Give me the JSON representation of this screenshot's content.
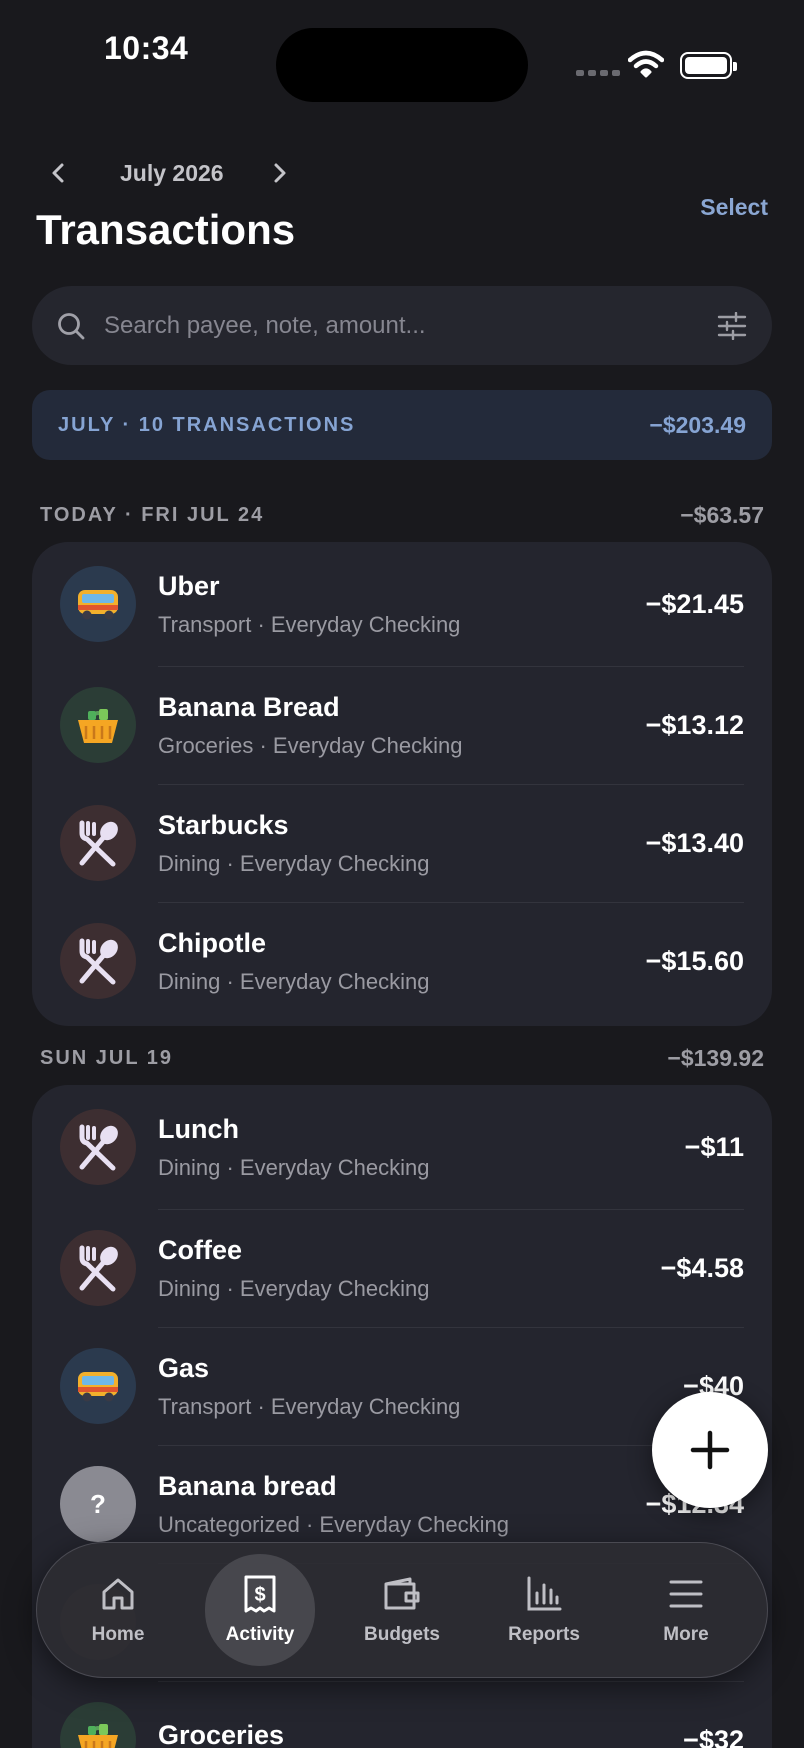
{
  "status_bar": {
    "time": "10:34"
  },
  "header": {
    "month": "July 2026",
    "title": "Transactions",
    "select_label": "Select"
  },
  "search": {
    "placeholder": "Search payee, note, amount..."
  },
  "summary": {
    "label": "JULY · 10 TRANSACTIONS",
    "total": "−$203.49"
  },
  "sections": [
    {
      "title": "TODAY · FRI JUL 24",
      "total": "−$63.57",
      "rows": [
        {
          "payee": "Uber",
          "meta": "Transport · Everyday Checking",
          "amount": "−$21.45",
          "icon": "bus-icon"
        },
        {
          "payee": "Banana Bread",
          "meta": "Groceries · Everyday Checking",
          "amount": "−$13.12",
          "icon": "basket-icon"
        },
        {
          "payee": "Starbucks",
          "meta": "Dining · Everyday Checking",
          "amount": "−$13.40",
          "icon": "fork-spoon-icon"
        },
        {
          "payee": "Chipotle",
          "meta": "Dining · Everyday Checking",
          "amount": "−$15.60",
          "icon": "fork-spoon-icon"
        }
      ]
    },
    {
      "title": "SUN JUL 19",
      "total": "−$139.92",
      "rows": [
        {
          "payee": "Lunch",
          "meta": "Dining · Everyday Checking",
          "amount": "−$11",
          "icon": "fork-spoon-icon"
        },
        {
          "payee": "Coffee",
          "meta": "Dining · Everyday Checking",
          "amount": "−$4.58",
          "icon": "fork-spoon-icon"
        },
        {
          "payee": "Gas",
          "meta": "Transport · Everyday Checking",
          "amount": "−$40",
          "icon": "bus-icon"
        },
        {
          "payee": "Banana bread",
          "meta": "Uncategorized · Everyday Checking",
          "amount": "−$12.34",
          "icon": "question-icon",
          "icon_text": "?"
        },
        {
          "payee": "",
          "meta": "",
          "amount": "",
          "icon": ""
        },
        {
          "payee": "Groceries",
          "meta": "",
          "amount": "−$32",
          "icon": "basket-icon"
        }
      ]
    }
  ],
  "tabbar": {
    "tabs": [
      {
        "label": "Home",
        "icon": "house-icon"
      },
      {
        "label": "Activity",
        "icon": "receipt-dollar-icon",
        "active": true
      },
      {
        "label": "Budgets",
        "icon": "wallet-icon"
      },
      {
        "label": "Reports",
        "icon": "bar-chart-icon"
      },
      {
        "label": "More",
        "icon": "menu-icon"
      }
    ]
  }
}
